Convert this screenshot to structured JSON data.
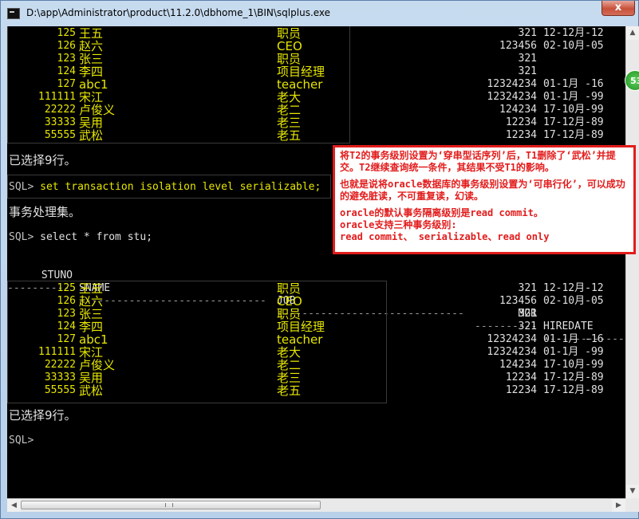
{
  "window": {
    "title": "D:\\app\\Administrator\\product\\11.2.0\\dbhome_1\\BIN\\sqlplus.exe",
    "close_label": "x"
  },
  "console": {
    "top_rows": [
      {
        "stuno": "125",
        "sname": "王五",
        "job": "职员",
        "mgr": "321",
        "hiredate": "12-12月-12"
      },
      {
        "stuno": "126",
        "sname": "赵六",
        "job": "CEO",
        "mgr": "123456",
        "hiredate": "02-10月-05"
      },
      {
        "stuno": "123",
        "sname": "张三",
        "job": "职员",
        "mgr": "321",
        "hiredate": ""
      },
      {
        "stuno": "124",
        "sname": "李四",
        "job": "项目经理",
        "mgr": "321",
        "hiredate": ""
      },
      {
        "stuno": "127",
        "sname": "abc1",
        "job": "teacher",
        "mgr": "12324234",
        "hiredate": "01-1月 -16"
      },
      {
        "stuno": "111111",
        "sname": "宋江",
        "job": "老大",
        "mgr": "12324234",
        "hiredate": "01-1月 -99"
      },
      {
        "stuno": "22222",
        "sname": "卢俊义",
        "job": "老二",
        "mgr": "124234",
        "hiredate": "17-10月-99"
      },
      {
        "stuno": "33333",
        "sname": "吴用",
        "job": "老三",
        "mgr": "12234",
        "hiredate": "17-12月-89"
      },
      {
        "stuno": "55555",
        "sname": "武松",
        "job": "老五",
        "mgr": "12234",
        "hiredate": "17-12月-89"
      }
    ],
    "selected_rows_1": "已选择9行。",
    "prompt_1": "SQL> ",
    "command_1": "set transaction isolation level serializable;",
    "result_1": "事务处理集。",
    "prompt_2": "SQL> ",
    "command_2": "select * from stu;",
    "headers": {
      "stuno": "STUNO",
      "sname": "SNAME",
      "job": "JOB",
      "mgr": "MGR",
      "hiredate": "HIREDATE"
    },
    "separator_stuno": "----------",
    "separator_sname": "------------------------------",
    "separator_job": "------------------------------",
    "separator_mgr": "----------",
    "separator_hiredate": "--------------",
    "bottom_rows": [
      {
        "stuno": "125",
        "sname": "王五",
        "job": "职员",
        "mgr": "321",
        "hiredate": "12-12月-12"
      },
      {
        "stuno": "126",
        "sname": "赵六",
        "job": "CEO",
        "mgr": "123456",
        "hiredate": "02-10月-05"
      },
      {
        "stuno": "123",
        "sname": "张三",
        "job": "职员",
        "mgr": "321",
        "hiredate": ""
      },
      {
        "stuno": "124",
        "sname": "李四",
        "job": "项目经理",
        "mgr": "321",
        "hiredate": ""
      },
      {
        "stuno": "127",
        "sname": "abc1",
        "job": "teacher",
        "mgr": "12324234",
        "hiredate": "01-1月 -16"
      },
      {
        "stuno": "111111",
        "sname": "宋江",
        "job": "老大",
        "mgr": "12324234",
        "hiredate": "01-1月 -99"
      },
      {
        "stuno": "22222",
        "sname": "卢俊义",
        "job": "老二",
        "mgr": "124234",
        "hiredate": "17-10月-99"
      },
      {
        "stuno": "33333",
        "sname": "吴用",
        "job": "老三",
        "mgr": "12234",
        "hiredate": "17-12月-89"
      },
      {
        "stuno": "55555",
        "sname": "武松",
        "job": "老五",
        "mgr": "12234",
        "hiredate": "17-12月-89"
      }
    ],
    "selected_rows_2": "已选择9行。",
    "prompt_3": "SQL>"
  },
  "annotation": {
    "line1": "将T2的事务级别设置为‘穿串型话序列’后，T1删除了‘武松’并提交。T2继续查询统一条件，其结果不受T1的影响。",
    "line2": "也就是说将oracle数据库的事务级别设置为‘可串行化’，可以成功的避免脏读，不可重复读，幻读。",
    "line3": "oracle的默认事务隔离级别是read commit。",
    "line4": "oracle支持三种事务级别:",
    "line5": "read commit、 serializable、read only"
  },
  "badge": {
    "text": "53"
  },
  "colors": {
    "console_bg": "#000000",
    "result_text": "#e6e600",
    "annotation_border": "#e21c1c"
  }
}
